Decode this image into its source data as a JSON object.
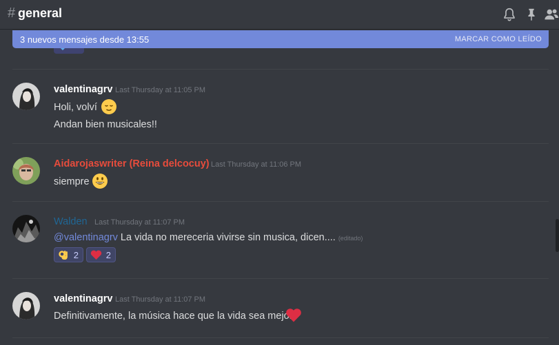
{
  "header": {
    "hash": "#",
    "channel": "general",
    "icons": [
      "bell-icon",
      "pin-icon",
      "members-icon"
    ]
  },
  "banner": {
    "text": "3 nuevos mensajes desde 13:55",
    "action": "MARCAR COMO LEÍDO"
  },
  "messages": [
    {
      "author": "valentinagrv",
      "author_color": "#ffffff",
      "timestamp": "Last Thursday at 11:05 PM",
      "lines": [
        "Holi, volví",
        "Andan bien musicales!!"
      ],
      "emoji": "relieved-face-emoji"
    },
    {
      "author": "Aidarojaswriter (Reina delcocuy)",
      "author_color": "#e74c3c",
      "timestamp": "Last Thursday at 11:06 PM",
      "lines": [
        "siempre"
      ],
      "emoji": "grinning-face-emoji"
    },
    {
      "author": "Walden",
      "author_color": "#206694",
      "timestamp": "Last Thursday at 11:07 PM",
      "mention": "@valentinagrv",
      "text": " La vida no mereceria vivirse sin musica, dicen....",
      "edited": "(editado)",
      "reactions": [
        {
          "emoji": "ok-hand-emoji",
          "count": "2"
        },
        {
          "emoji": "red-heart-emoji",
          "count": "2"
        }
      ]
    },
    {
      "author": "valentinagrv",
      "author_color": "#ffffff",
      "timestamp": "Last Thursday at 11:07 PM",
      "lines": [
        "Definitivamente, la música hace que la vida sea mejor"
      ],
      "emoji": "red-heart-emoji"
    }
  ],
  "colors": {
    "background": "#36393f",
    "accent": "#7289da",
    "text": "#dcddde",
    "muted": "#72767d"
  }
}
